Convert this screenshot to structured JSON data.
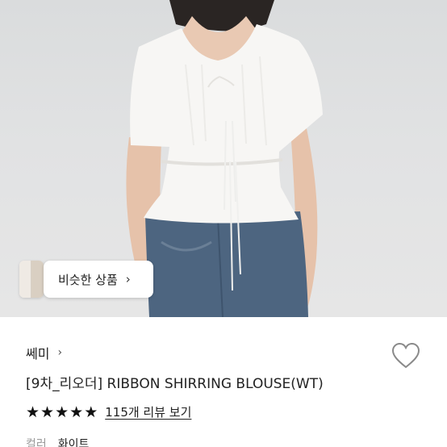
{
  "product_image": {
    "alt": ""
  },
  "similar_products": {
    "label": "비슷한 상품",
    "chevron": "›"
  },
  "shop": {
    "name": "쎄미",
    "chevron": "›"
  },
  "wishlist": {
    "icon": "heart-outline-icon"
  },
  "product": {
    "title": "[9차_리오더] RIBBON SHIRRING BLOUSE(WT)"
  },
  "rating": {
    "stars": 5,
    "star_glyph": "★",
    "reviews_link": "115개 리뷰 보기"
  },
  "option": {
    "label": "컬러",
    "value": "화이트"
  }
}
